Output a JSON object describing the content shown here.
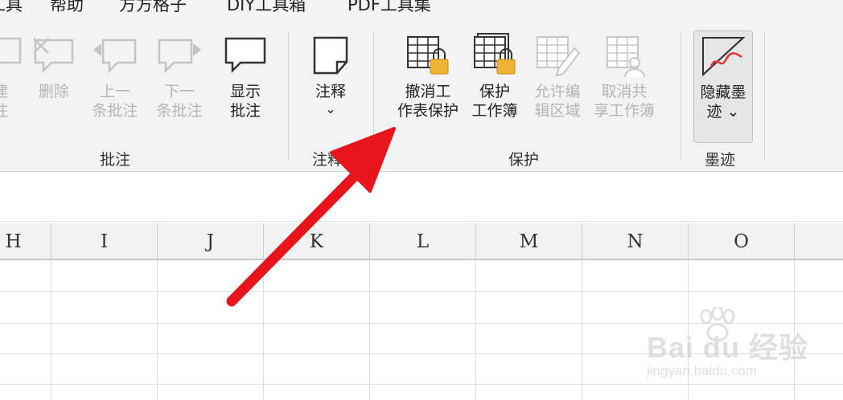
{
  "menu": {
    "items": [
      "工具",
      "帮助",
      "方方格子",
      "DIY工具箱",
      "PDF工具集"
    ]
  },
  "ribbon": {
    "comments_group": {
      "label": "批注",
      "new_comment": [
        "建",
        "注"
      ],
      "delete": "删除",
      "previous": [
        "上一",
        "条批注"
      ],
      "next": [
        "下一",
        "条批注"
      ],
      "show": [
        "显示",
        "批注"
      ]
    },
    "notes_group": {
      "label": "注释",
      "notes": "注释",
      "notes_chevron": "⌄"
    },
    "protect_group": {
      "label": "保护",
      "unprotect_sheet": [
        "撤消工",
        "作表保护"
      ],
      "protect_workbook": [
        "保护",
        "工作簿"
      ],
      "allow_edit_ranges": [
        "允许编",
        "辑区域"
      ],
      "unshare_workbook": [
        "取消共",
        "享工作簿"
      ]
    },
    "ink_group": {
      "label": "墨迹",
      "hide_ink": [
        "隐藏墨",
        "迹 ⌄"
      ]
    }
  },
  "sheet": {
    "columns": [
      "H",
      "I",
      "J",
      "K",
      "L",
      "M",
      "N",
      "O"
    ]
  },
  "watermark": {
    "brand": "Bai du 经验",
    "url": "jingyan.baidu.com"
  },
  "colors": {
    "arrow": "#e8141c",
    "lock": "#f2b233",
    "ink_stroke": "#e0333a"
  }
}
